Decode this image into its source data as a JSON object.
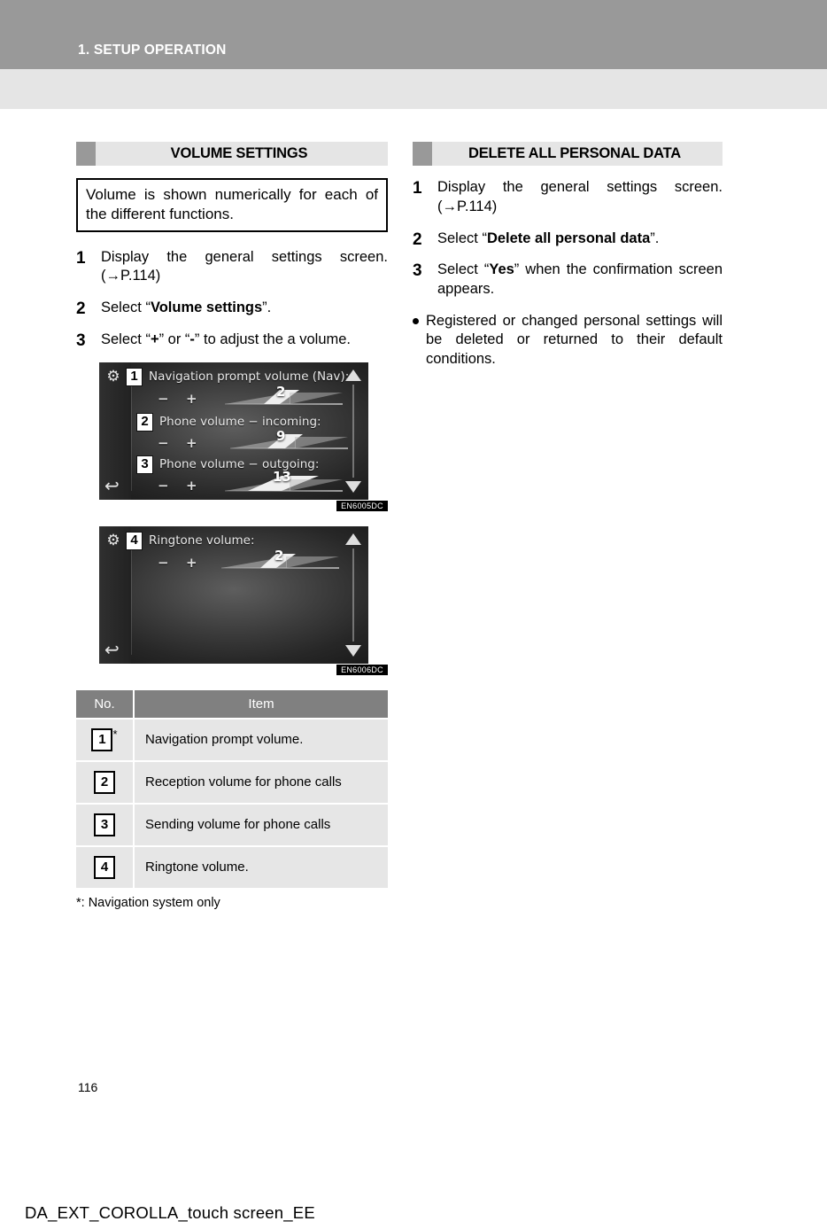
{
  "header": {
    "chapter_title": "1. SETUP OPERATION",
    "band_color": "#999999",
    "subband_color": "#e5e5e5"
  },
  "left_column": {
    "section": {
      "title": "VOLUME SETTINGS"
    },
    "note_box": {
      "text": "Volume is shown numerically for each of the different functions."
    },
    "steps": [
      {
        "num": "1",
        "text_before": "Display the general settings screen. (",
        "arrow": "→",
        "ref": "P.114",
        "text_after": ")"
      },
      {
        "num": "2",
        "text_before": "Select “",
        "bold": "Volume settings",
        "text_after": "”."
      },
      {
        "num": "3",
        "text_before": "Select “",
        "bold": "+",
        "text_mid": "” or “",
        "bold2": "-",
        "text_after": "” to adjust the a volume."
      }
    ],
    "screenshot_1": {
      "code": "EN6005DC",
      "gear_icon": "gear-icon",
      "back_icon": "back-arrow-icon",
      "rows": [
        {
          "badge": "1",
          "label": "Navigation prompt volume (Nav):",
          "minus": "−",
          "plus": "+",
          "value": "2"
        },
        {
          "badge": "2",
          "label": "Phone volume − incoming:",
          "minus": "−",
          "plus": "+",
          "value": "9"
        },
        {
          "badge": "3",
          "label": "Phone volume − outgoing:",
          "minus": "−",
          "plus": "+",
          "value": "13"
        }
      ]
    },
    "screenshot_2": {
      "code": "EN6006DC",
      "gear_icon": "gear-icon",
      "back_icon": "back-arrow-icon",
      "rows": [
        {
          "badge": "4",
          "label": "Ringtone volume:",
          "minus": "−",
          "plus": "+",
          "value": "2"
        }
      ]
    },
    "table": {
      "columns": [
        "No.",
        "Item"
      ],
      "rows": [
        {
          "no": "1",
          "star": "*",
          "item": "Navigation prompt volume."
        },
        {
          "no": "2",
          "star": "",
          "item": "Reception volume for phone calls"
        },
        {
          "no": "3",
          "star": "",
          "item": "Sending volume for phone calls"
        },
        {
          "no": "4",
          "star": "",
          "item": "Ringtone volume."
        }
      ]
    },
    "footnote": "*: Navigation system only"
  },
  "right_column": {
    "section": {
      "title": "DELETE ALL PERSONAL DATA"
    },
    "steps": [
      {
        "num": "1",
        "text_before": "Display the general settings screen. (",
        "arrow": "→",
        "ref": "P.114",
        "text_after": ")"
      },
      {
        "num": "2",
        "text_before": "Select “",
        "bold": "Delete all personal data",
        "text_after": "”."
      },
      {
        "num": "3",
        "text_before": "Select “",
        "bold": "Yes",
        "text_after": "” when the confirmation screen appears."
      }
    ],
    "bullet": "Registered or changed personal settings will be deleted or returned to their default conditions."
  },
  "footer": {
    "page_number": "116",
    "doc_id": "DA_EXT_COROLLA_touch screen_EE"
  }
}
